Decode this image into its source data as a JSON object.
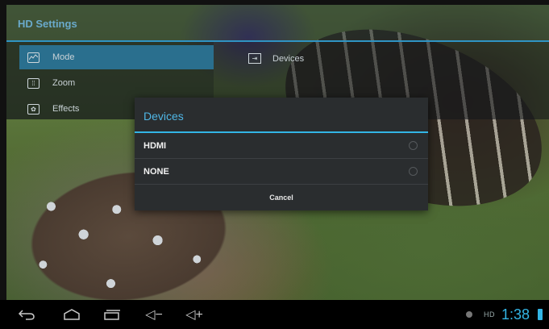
{
  "app": {
    "title": "HD Settings"
  },
  "menu": {
    "items": [
      {
        "label": "Mode",
        "icon": "mode-icon"
      },
      {
        "label": "Zoom",
        "icon": "zoom-icon"
      },
      {
        "label": "Effects",
        "icon": "effects-icon"
      }
    ]
  },
  "detail": {
    "devices_label": "Devices",
    "icon": "devices-icon"
  },
  "dialog": {
    "title": "Devices",
    "options": [
      {
        "label": "HDMI",
        "selected": false
      },
      {
        "label": "NONE",
        "selected": false
      }
    ],
    "cancel_label": "Cancel"
  },
  "navbar": {
    "buttons": [
      "back-icon",
      "home-icon",
      "recent-apps-icon",
      "volume-down-icon",
      "volume-up-icon"
    ],
    "volume_down_glyph": "◁−",
    "volume_up_glyph": "◁+",
    "hd_label": "HD",
    "time": "1:38"
  },
  "colors": {
    "accent": "#33b5e5",
    "dialog_bg": "#2a2d2f",
    "selected_menu": "#2a6f8e"
  }
}
